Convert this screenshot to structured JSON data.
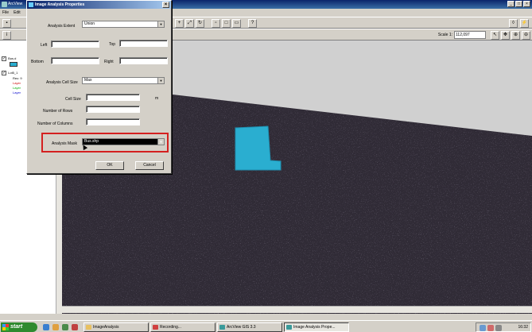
{
  "app": {
    "title": "ArcView"
  },
  "menu": [
    "File",
    "Edit"
  ],
  "scale": {
    "label": "Scale 1:",
    "value": "112,097"
  },
  "toc": {
    "layer1": "Bus.d",
    "layer2": "Lot5_1",
    "layer2_sub": "Rec: 9",
    "legend": [
      "Layer",
      "Layer",
      "Layer"
    ]
  },
  "dialog": {
    "title": "Image Analysis Properties",
    "close": "×",
    "analysis_extent_label": "Analysis Extent",
    "analysis_extent_value": "Union",
    "left_label": "Left",
    "top_label": "Top",
    "bottom_label": "Bottom",
    "right_label": "Right",
    "cell_size_combo_label": "Analysis Cell Size",
    "cell_size_combo_value": "Max",
    "cell_size_label": "Cell Size",
    "cell_size_unit": "m",
    "rows_label": "Number of Rows",
    "cols_label": "Number of Columns",
    "mask_label": "Analysis Mask",
    "mask_value": "Bus.shp",
    "ok": "OK",
    "cancel": "Cancel"
  },
  "taskbar": {
    "start": "start",
    "tasks": [
      "ImageAnalysis",
      "Recording...",
      "ArcView GIS 3.3",
      "Image Analysis Prope..."
    ],
    "clock": "16:32"
  },
  "colors": {
    "mask_highlight": "#d42020",
    "polygon": "#2aaed0"
  }
}
